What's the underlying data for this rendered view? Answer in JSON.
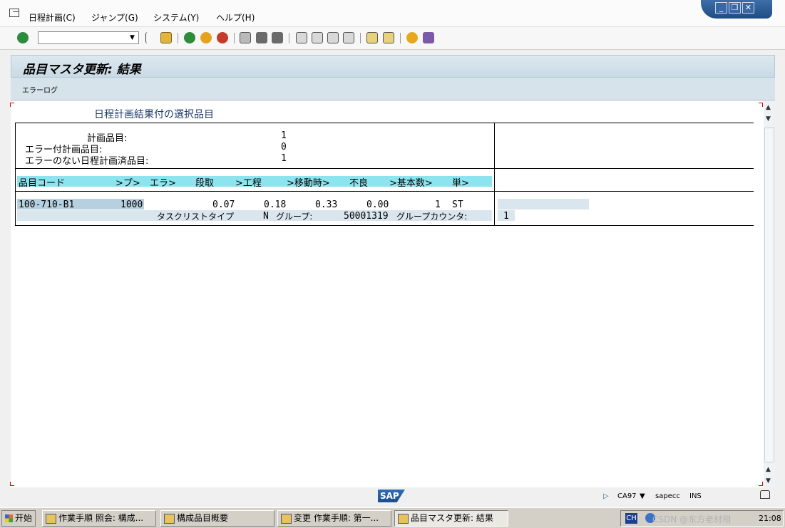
{
  "menu": {
    "items": [
      "日程計画(C)",
      "ジャンプ(G)",
      "システム(Y)",
      "ヘルプ(H)"
    ]
  },
  "toolbar": {
    "command_value": "",
    "dropdown_glyph": "▼"
  },
  "window_controls": {
    "minimize": "_",
    "restore": "❐",
    "close": "✕"
  },
  "screen": {
    "title": "品目マスタ更新: 結果",
    "app_button": "エラーログ"
  },
  "list": {
    "heading": "日程計画結果付の選択品目",
    "summary": [
      {
        "label": "計画品目:",
        "value": "1"
      },
      {
        "label": "エラー付計画品目:",
        "value": "0"
      },
      {
        "label": "エラーのない日程計画済品目:",
        "value": "1"
      }
    ],
    "columns": [
      "品目コード",
      ">プ>",
      "エラ>",
      "段取",
      ">工程",
      ">移動時>",
      "不良",
      ">基本数>",
      "単>"
    ],
    "rows": [
      {
        "material": "100-710-B1",
        "plant": "1000",
        "setup": "0.07",
        "process": "0.18",
        "move": "0.33",
        "scrap": "0.00",
        "base_qty": "1",
        "unit": "ST",
        "task_type_label": "タスクリストタイプ",
        "task_type_value": "N",
        "group_label": "グループ:",
        "group_value": "50001319",
        "counter_label": "グループカウンタ:",
        "counter_value": "1"
      }
    ]
  },
  "status": {
    "logo": "SAP",
    "transaction": "CA97",
    "dropdown_glyph": "▼",
    "system": "sapecc",
    "mode": "INS"
  },
  "taskbar": {
    "start": "开始",
    "tasks": [
      "作業手順 照会: 構成...",
      "構成品目概要",
      "変更 作業手順: 第一...",
      "品目マスタ更新: 結果"
    ],
    "tray_lang": "CH",
    "watermark": "CSDN @东方老材相",
    "clock": "21:08"
  },
  "colors": {
    "title_bg": "#d0dfe9",
    "column_bar": "#8ce4ee",
    "row_highlight": "#b7d0e0",
    "window_controls": "#2b5a94"
  }
}
